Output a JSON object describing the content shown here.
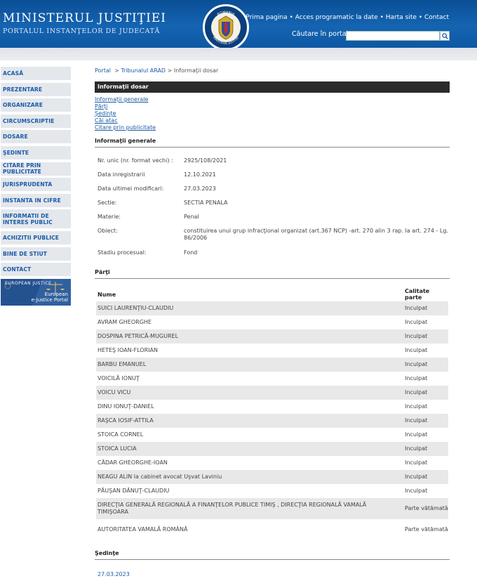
{
  "header": {
    "title": "MINISTERUL JUSTIŢIEI",
    "subtitle": "PORTALUL INSTANŢELOR DE JUDECATĂ",
    "crest_top": "ROMANIA",
    "crest_bottom": "MINISTERUL JUSTITIEI",
    "links": [
      "Prima pagina",
      "Acces programatic la date",
      "Harta site",
      "Contact"
    ],
    "separator": "•",
    "search_label": "Căutare în portal",
    "search_value": "",
    "search_icon": "magnifier-icon"
  },
  "sidebar": {
    "items": [
      "ACASĂ",
      "PREZENTARE",
      "ORGANIZARE",
      "CIRCUMSCRIPTIE",
      "DOSARE",
      "ŞEDINTE",
      "CITARE PRIN PUBLICITATE",
      "JURISPRUDENTA",
      "INSTANTA IN CIFRE",
      "INFORMATII DE INTERES PUBLIC",
      "ACHIZITII PUBLICE",
      "BINE DE STIUT",
      "CONTACT"
    ],
    "banner_logo": "EUROPEAN JUSTICE",
    "banner_text_1": "European",
    "banner_text_2": "e-Justice Portal"
  },
  "breadcrumb": {
    "portal": "Portal",
    "sep": ">",
    "court": "Tribunalul ARAD",
    "current": "Informaţii dosar"
  },
  "page_title": "Informaţii dosar",
  "quick_links": [
    "Informaţii generale",
    "Părţi",
    "Şedinţe",
    "Căi atac",
    "Citare prin publicitate"
  ],
  "general": {
    "heading": "Informaţii generale",
    "rows": [
      {
        "label": "Nr. unic (nr. format vechi) :",
        "value": "2925/108/2021"
      },
      {
        "label": "Data inregistrarii",
        "value": "12.10.2021"
      },
      {
        "label": "Data ultimei modificari:",
        "value": "27.03.2023"
      },
      {
        "label": "Sectie:",
        "value": "SECTIA PENALA"
      },
      {
        "label": "Materie:",
        "value": "Penal"
      },
      {
        "label": "Obiect:",
        "value": "constituirea unui grup infracţional organizat (art.367 NCP) -art. 270 alin 3 rap. la art. 274 - Lg. 86/2006"
      },
      {
        "label": "Stadiu procesual:",
        "value": "Fond"
      }
    ]
  },
  "parti": {
    "heading": "Părţi",
    "col_name": "Nume",
    "col_role": "Calitate parte",
    "rows": [
      {
        "name": "SUICI LAURENŢIU-CLAUDIU",
        "role": "Inculpat"
      },
      {
        "name": "AVRAM GHEORGHE",
        "role": "Inculpat"
      },
      {
        "name": "DOSPINA PETRICĂ-MUGUREL",
        "role": "Inculpat"
      },
      {
        "name": "HETEŞ IOAN-FLORIAN",
        "role": "Inculpat"
      },
      {
        "name": "BARBU EMANUEL",
        "role": "Inculpat"
      },
      {
        "name": "VOICILĂ IONUŢ",
        "role": "Inculpat"
      },
      {
        "name": "VOICU VICU",
        "role": "Inculpat"
      },
      {
        "name": "DINU IONUŢ-DANIEL",
        "role": "Inculpat"
      },
      {
        "name": "RAŞCA IOSIF-ATTILA",
        "role": "Inculpat"
      },
      {
        "name": "STOICA CORNEL",
        "role": "Inculpat"
      },
      {
        "name": "STOICA LUCIA",
        "role": "Inculpat"
      },
      {
        "name": "CĂDAR GHEORGHE-IOAN",
        "role": "Inculpat"
      },
      {
        "name": "NEAGU ALIN la cabinet avocat Uşvat Laviniu",
        "role": "Inculpat"
      },
      {
        "name": "PĂUŞAN DĂNUŢ-CLAUDIU",
        "role": "Inculpat"
      },
      {
        "name": "DIRECŢIA GENERALĂ REGIONALĂ A FINANŢELOR PUBLICE TIMIŞ , DIRECŢIA REGIONALĂ VAMALĂ TIMIŞOARA",
        "role": "Parte vătămată"
      },
      {
        "name": "AUTORITATEA VAMALĂ ROMÂNĂ",
        "role": "Parte vătămată"
      }
    ]
  },
  "sedinte": {
    "heading": "Şedinţe",
    "first_date": "27.03.2023"
  }
}
